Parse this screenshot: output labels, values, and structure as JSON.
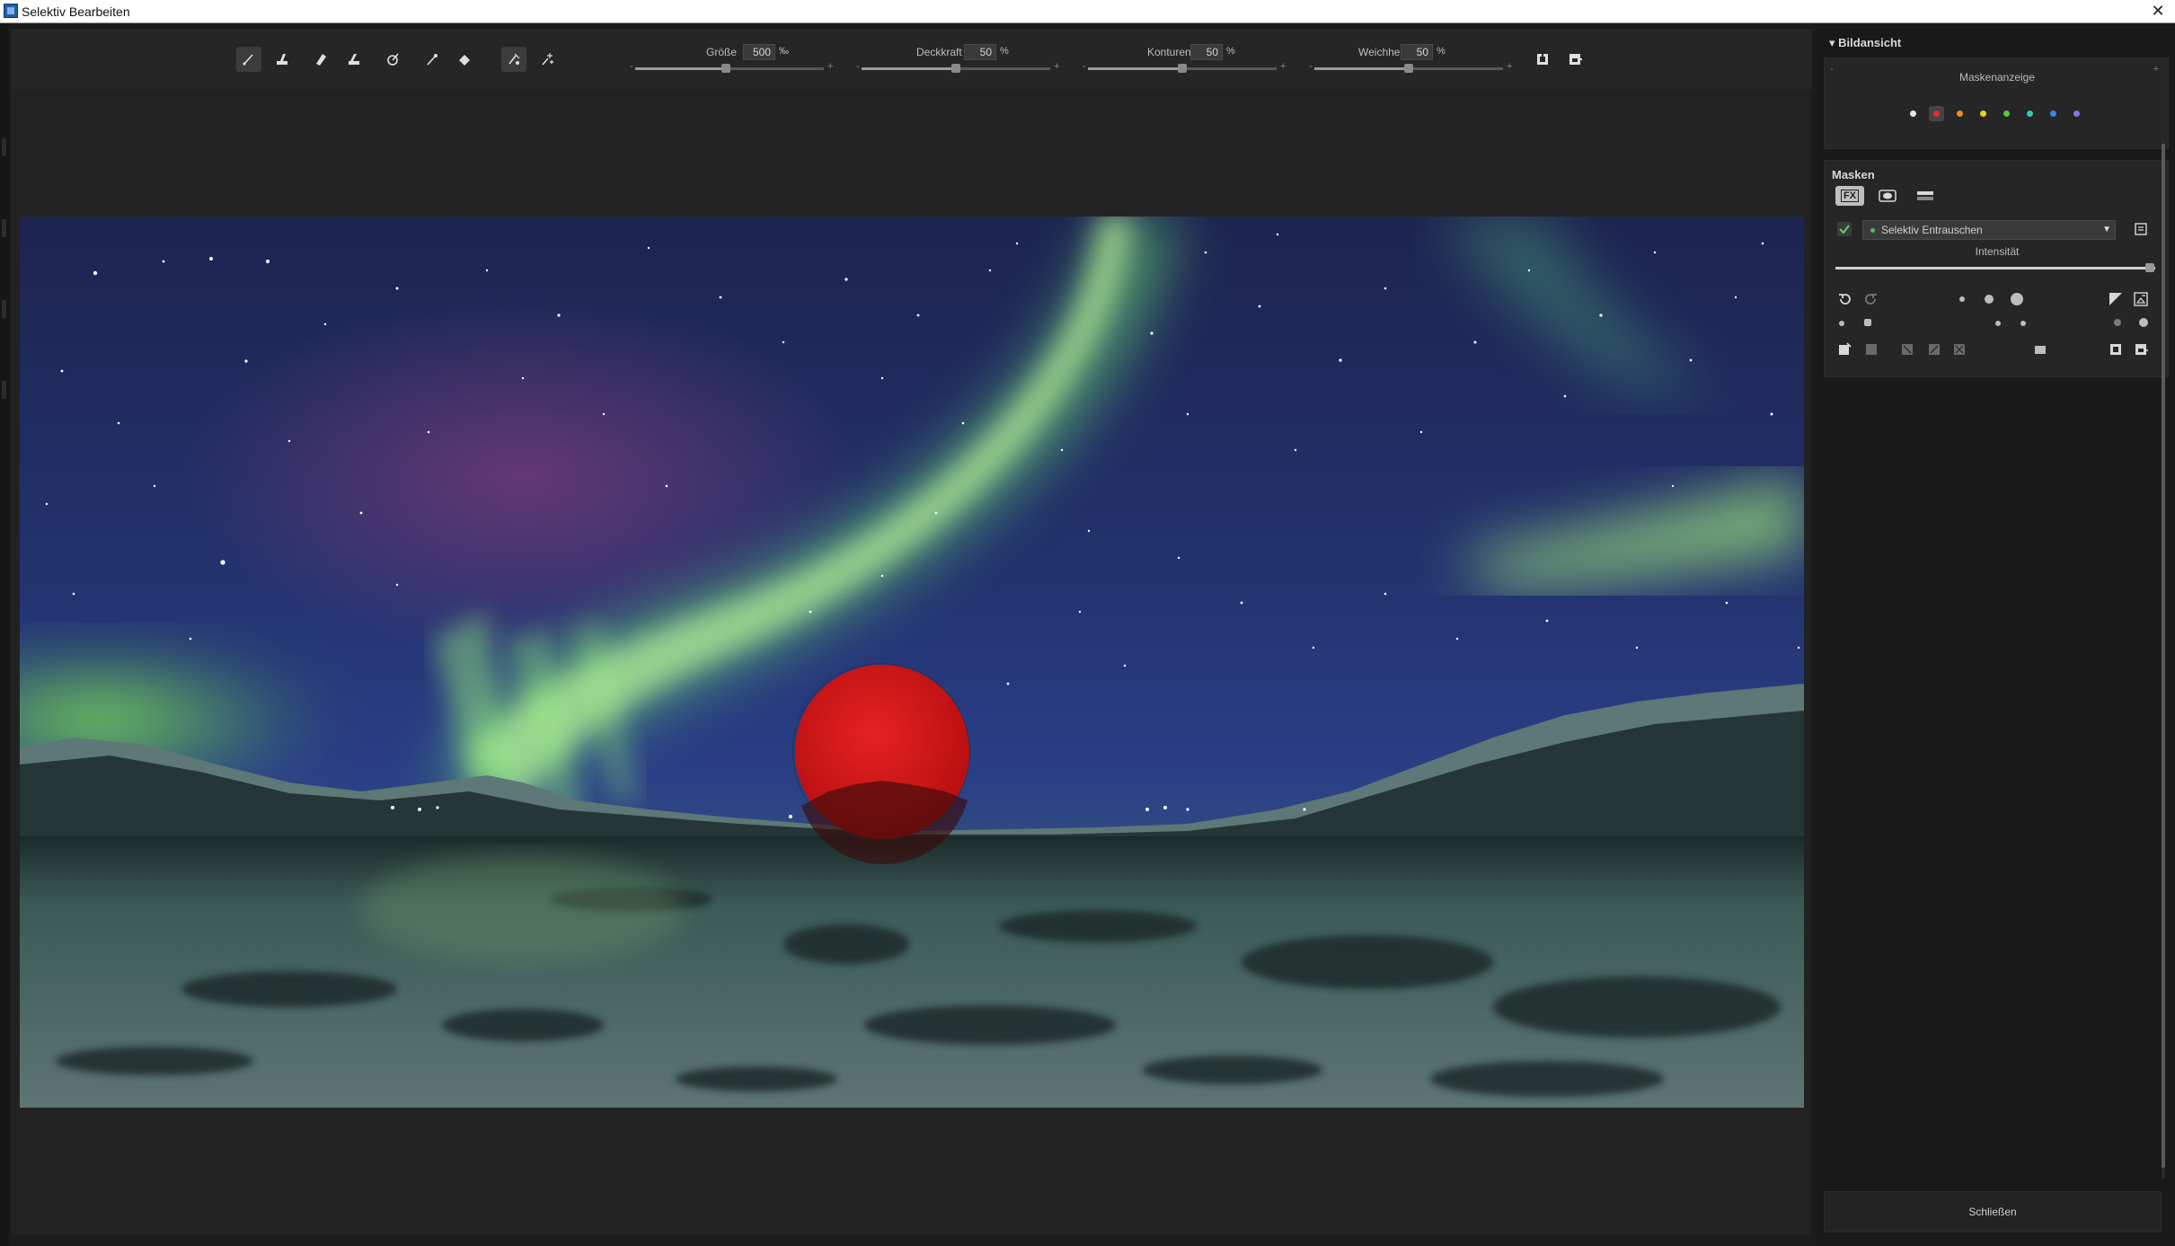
{
  "window": {
    "title": "Selektiv Bearbeiten",
    "close_glyph": "✕",
    "app_icon": "app-icon"
  },
  "toolbar": {
    "tools": [
      {
        "id": "brush-icon",
        "active": true
      },
      {
        "id": "stamp-brush-icon",
        "active": false
      },
      {
        "id": "eraser-icon",
        "active": false
      },
      {
        "id": "eraser-brush-icon",
        "active": false
      },
      {
        "id": "magic-brush-icon",
        "active": false
      },
      {
        "id": "pipette-icon",
        "active": false
      },
      {
        "id": "fill-bucket-icon",
        "active": false
      },
      {
        "id": "edge-brush-icon",
        "active": true
      },
      {
        "id": "sparkle-brush-icon",
        "active": false
      }
    ],
    "sliders": [
      {
        "name": "groesse",
        "label": "Größe",
        "value": "500",
        "unit": "‰",
        "fraction": 0.48
      },
      {
        "name": "deckkraft",
        "label": "Deckkraft",
        "value": "50",
        "unit": "%",
        "fraction": 0.5
      },
      {
        "name": "konturen",
        "label": "Konturen",
        "value": "50",
        "unit": "%",
        "fraction": 0.5
      },
      {
        "name": "weichheit",
        "label": "Weichheit",
        "value": "50",
        "unit": "%",
        "fraction": 0.5
      }
    ],
    "minus_glyph": "-",
    "plus_glyph": "+",
    "right_icons": [
      "load-mask-icon",
      "save-mask-icon"
    ]
  },
  "canvas": {
    "brush_color": "#d11a1a"
  },
  "panel": {
    "section_title": "Bildansicht",
    "collapse_glyph": "▾",
    "maskenanzeige": {
      "label": "Maskenanzeige",
      "minus_glyph": "-",
      "plus_glyph": "+",
      "colors": [
        "#e6e6e6",
        "#e03030",
        "#f08c1e",
        "#e6d21e",
        "#5ac83c",
        "#2ec8b4",
        "#3c82f0",
        "#8c6ef0"
      ],
      "selected_index": 1
    },
    "masken": {
      "title": "Masken",
      "tabs": [
        {
          "id": "fx",
          "label": "FX",
          "active": true
        },
        {
          "id": "eye",
          "label": "",
          "active": false
        },
        {
          "id": "layers",
          "label": "",
          "active": false
        }
      ],
      "effect_dropdown": "Selektiv Entrauschen",
      "dropdown_arrow": "▼",
      "intensitaet_label": "Intensität",
      "intensitaet_fraction": 1.0
    },
    "close_button": "Schließen"
  }
}
